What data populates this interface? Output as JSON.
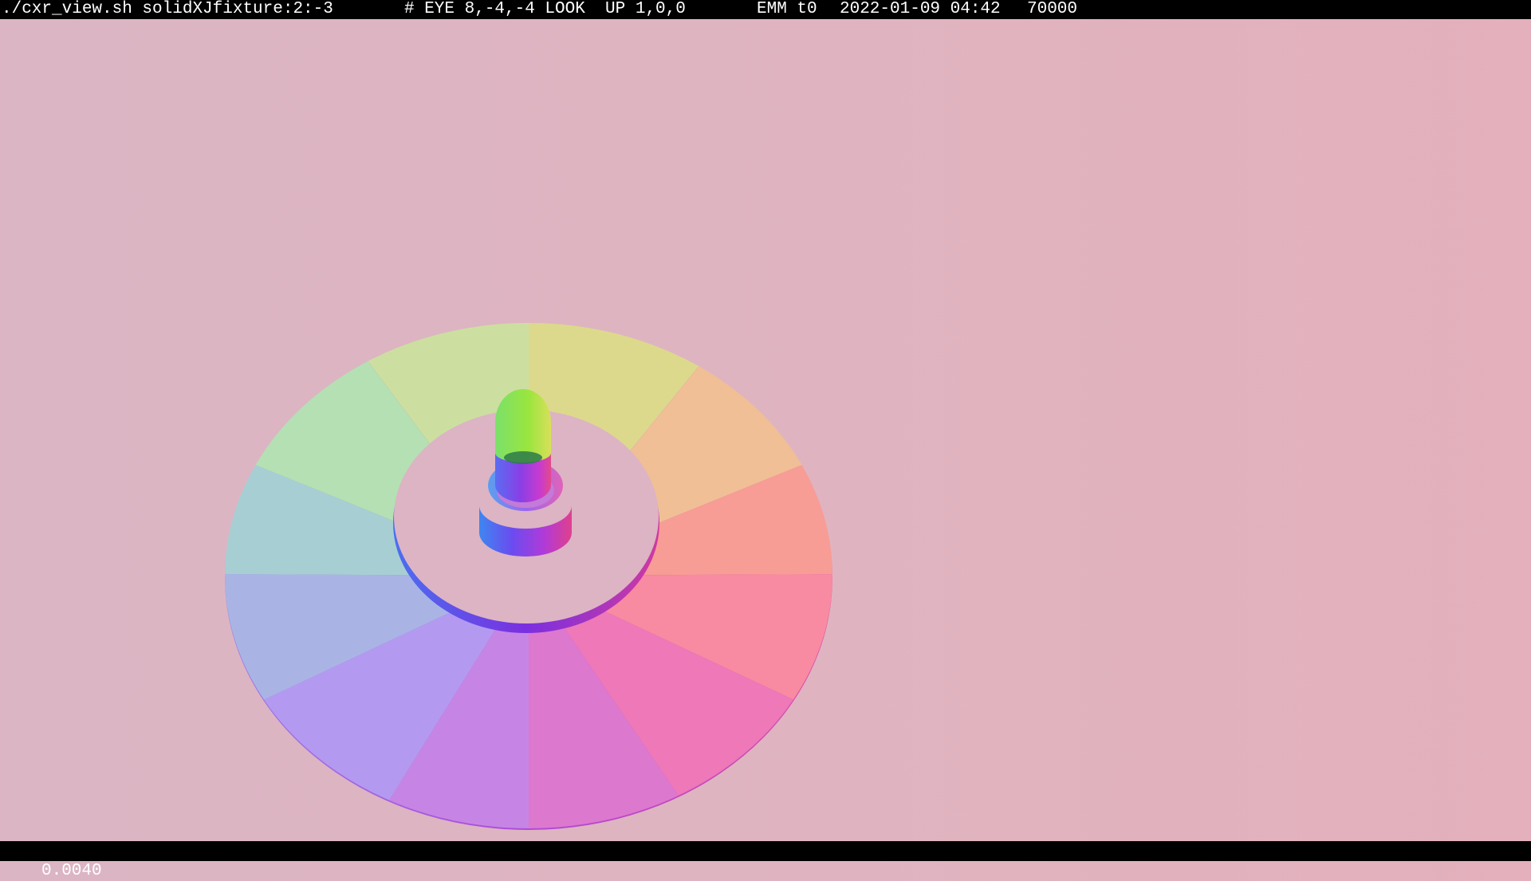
{
  "title_bar": {
    "command": "./cxr_view.sh solidXJfixture:2:-3",
    "camera": "# EYE 8,-4,-4 LOOK  UP 1,0,0",
    "mode": "EMM t0",
    "datetime": "2022-01-09 04:42",
    "count": "70000"
  },
  "status_bar": {
    "value": "0.0040"
  },
  "colors": {
    "background": "#ddb4c2",
    "bar_bg": "#000000",
    "bar_text": "#ffffff"
  }
}
